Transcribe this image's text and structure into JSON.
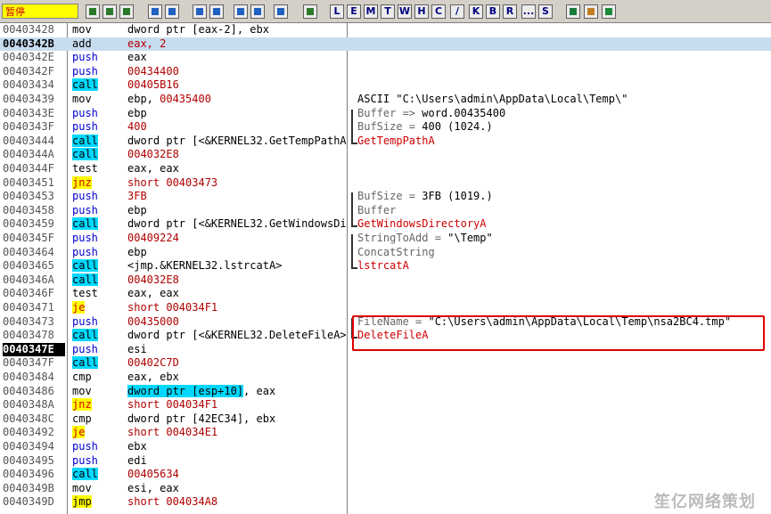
{
  "toolbar": {
    "status": "暂停",
    "icons": [
      "open-icon",
      "rewind-icon",
      "close-icon",
      "run-icon",
      "pause-icon",
      "step-into-icon",
      "step-over-icon",
      "trace-into-icon",
      "trace-over-icon",
      "execute-till-return-icon",
      "goto-icon"
    ],
    "letters": [
      "L",
      "E",
      "M",
      "T",
      "W",
      "H",
      "C",
      "/",
      "K",
      "B",
      "R",
      "...",
      "S"
    ],
    "tail_icons": [
      "list-icon",
      "grid-icon",
      "help-icon"
    ]
  },
  "colors": {
    "call_bg": "#00d8ff",
    "jump_bg": "#ffff00",
    "api_red": "#d00000",
    "push_blue": "#0000d0"
  },
  "rows": [
    {
      "addr": "00403428",
      "mn": "mov",
      "mt": "",
      "op": "dword ptr [eax-2], ebx",
      "cm": "",
      "cmc": ""
    },
    {
      "addr": "0040342B",
      "mn": "add",
      "mt": "",
      "op": "eax, 2",
      "opc": "op-red",
      "cm": "",
      "cmc": "",
      "sel": true,
      "abold": true
    },
    {
      "addr": "0040342E",
      "mn": "push",
      "mt": "m-push",
      "op": "eax",
      "cm": "",
      "cmc": ""
    },
    {
      "addr": "0040342F",
      "mn": "push",
      "mt": "m-push",
      "op": "00434400",
      "opc": "op-red",
      "cm": "",
      "cmc": ""
    },
    {
      "addr": "00403434",
      "mn": "call",
      "mt": "m-call",
      "op": "00405B16",
      "opc": "op-red",
      "cm": "",
      "cmc": ""
    },
    {
      "addr": "00403439",
      "mn": "mov",
      "mt": "",
      "op": "ebp, 00435400",
      "op2": true,
      "cm": "ASCII \"C:\\Users\\admin\\AppData\\Local\\Temp\\\"",
      "cmc": ""
    },
    {
      "addr": "0040343E",
      "mn": "push",
      "mt": "m-push",
      "op": "ebp",
      "cm": "Buffer => word.00435400",
      "cmc": "cm-grey",
      "cm2": "word.00435400"
    },
    {
      "addr": "0040343F",
      "mn": "push",
      "mt": "m-push",
      "op": "400",
      "opc": "op-red",
      "cm": "BufSize = 400 (1024.)",
      "cmc": "cm-grey",
      "cm2": "400 (1024.)"
    },
    {
      "addr": "00403444",
      "mn": "call",
      "mt": "m-call",
      "op": "dword ptr [<&KERNEL32.GetTempPathA>]",
      "cm": "GetTempPathA",
      "cmc": "cm-red"
    },
    {
      "addr": "0040344A",
      "mn": "call",
      "mt": "m-call",
      "op": "004032E8",
      "opc": "op-red",
      "cm": "",
      "cmc": ""
    },
    {
      "addr": "0040344F",
      "mn": "test",
      "mt": "",
      "op": "eax, eax",
      "cm": "",
      "cmc": ""
    },
    {
      "addr": "00403451",
      "mn": "jnz",
      "mt": "m-jcc",
      "op": "short 00403473",
      "opc": "op-red",
      "cm": "",
      "cmc": ""
    },
    {
      "addr": "00403453",
      "mn": "push",
      "mt": "m-push",
      "op": "3FB",
      "opc": "op-red",
      "cm": "BufSize = 3FB (1019.)",
      "cmc": "cm-grey",
      "cm2": "3FB (1019.)"
    },
    {
      "addr": "00403458",
      "mn": "push",
      "mt": "m-push",
      "op": "ebp",
      "cm": "Buffer",
      "cmc": "cm-grey"
    },
    {
      "addr": "00403459",
      "mn": "call",
      "mt": "m-call",
      "op": "dword ptr [<&KERNEL32.GetWindowsDirectoryA>]",
      "cm": "GetWindowsDirectoryA",
      "cmc": "cm-red"
    },
    {
      "addr": "0040345F",
      "mn": "push",
      "mt": "m-push",
      "op": "00409224",
      "opc": "op-red",
      "cm": "StringToAdd = \"\\Temp\"",
      "cmc": "cm-grey",
      "cm2": "\"\\Temp\""
    },
    {
      "addr": "00403464",
      "mn": "push",
      "mt": "m-push",
      "op": "ebp",
      "cm": "ConcatString",
      "cmc": "cm-grey"
    },
    {
      "addr": "00403465",
      "mn": "call",
      "mt": "m-call",
      "op": "<jmp.&KERNEL32.lstrcatA>",
      "cm": "lstrcatA",
      "cmc": "cm-red"
    },
    {
      "addr": "0040346A",
      "mn": "call",
      "mt": "m-call",
      "op": "004032E8",
      "opc": "op-red",
      "cm": "",
      "cmc": ""
    },
    {
      "addr": "0040346F",
      "mn": "test",
      "mt": "",
      "op": "eax, eax",
      "cm": "",
      "cmc": ""
    },
    {
      "addr": "00403471",
      "mn": "je",
      "mt": "m-jcc",
      "op": "short 004034F1",
      "opc": "op-red",
      "cm": "",
      "cmc": ""
    },
    {
      "addr": "00403473",
      "mn": "push",
      "mt": "m-push",
      "op": "00435000",
      "opc": "op-red",
      "cm": "FileName = \"C:\\Users\\admin\\AppData\\Local\\Temp\\nsa2BC4.tmp\"",
      "cmc": "cm-grey",
      "cm2": "\"C:\\Users\\admin\\AppData\\Local\\Temp\\nsa2BC4.tmp\""
    },
    {
      "addr": "00403478",
      "mn": "call",
      "mt": "m-call",
      "op": "dword ptr [<&KERNEL32.DeleteFileA>]",
      "cm": "DeleteFileA",
      "cmc": "cm-red"
    },
    {
      "addr": "0040347E",
      "mn": "push",
      "mt": "m-push",
      "op": "esi",
      "cm": "",
      "cmc": "",
      "ahl": true
    },
    {
      "addr": "0040347F",
      "mn": "call",
      "mt": "m-call",
      "op": "00402C7D",
      "opc": "op-red",
      "cm": "",
      "cmc": ""
    },
    {
      "addr": "00403484",
      "mn": "cmp",
      "mt": "",
      "op": "eax, ebx",
      "cm": "",
      "cmc": ""
    },
    {
      "addr": "00403486",
      "mn": "mov",
      "mt": "",
      "op": "dword ptr [esp+10]",
      "opbox": true,
      "op3": ", eax",
      "cm": "",
      "cmc": ""
    },
    {
      "addr": "0040348A",
      "mn": "jnz",
      "mt": "m-jcc",
      "op": "short 004034F1",
      "opc": "op-red",
      "cm": "",
      "cmc": ""
    },
    {
      "addr": "0040348C",
      "mn": "cmp",
      "mt": "",
      "op": "dword ptr [42EC34], ebx",
      "cm": "",
      "cmc": ""
    },
    {
      "addr": "00403492",
      "mn": "je",
      "mt": "m-jcc",
      "op": "short 004034E1",
      "opc": "op-red",
      "cm": "",
      "cmc": ""
    },
    {
      "addr": "00403494",
      "mn": "push",
      "mt": "m-push",
      "op": "ebx",
      "cm": "",
      "cmc": ""
    },
    {
      "addr": "00403495",
      "mn": "push",
      "mt": "m-push",
      "op": "edi",
      "cm": "",
      "cmc": ""
    },
    {
      "addr": "00403496",
      "mn": "call",
      "mt": "m-call",
      "op": "00405634",
      "opc": "op-red",
      "cm": "",
      "cmc": ""
    },
    {
      "addr": "0040349B",
      "mn": "mov",
      "mt": "",
      "op": "esi, eax",
      "cm": "",
      "cmc": ""
    },
    {
      "addr": "0040349D",
      "mn": "jmp",
      "mt": "m-jmp",
      "op": "short 004034A8",
      "opc": "op-red",
      "cm": "",
      "cmc": ""
    }
  ],
  "watermark": "笙亿网络策划"
}
